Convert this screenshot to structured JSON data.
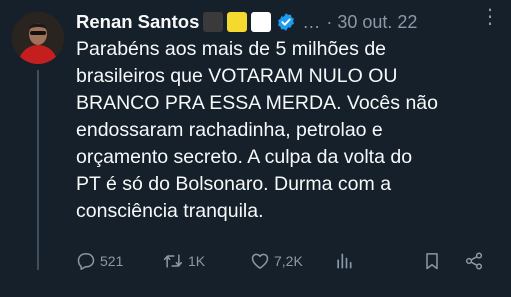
{
  "tweet": {
    "author": {
      "name": "Renan Santos",
      "badge_emojis": [
        "#3a3a3a",
        "#f5d92e",
        "#ffffff"
      ],
      "verified_color": "#1d9bf0"
    },
    "header_sep": "…",
    "date": "· 30 out. 22",
    "more_icon": "⋮",
    "text_lines": [
      "Parabéns aos mais de 5 milhões de",
      "brasileiros que VOTARAM NULO OU",
      "BRANCO PRA ESSA MERDA. Vocês não",
      "endossaram rachadinha, petrolao e",
      "orçamento secreto. A culpa da volta do",
      "PT é só do Bolsonaro. Durma com a",
      "consciência tranquila."
    ],
    "actions": {
      "replies": "521",
      "retweets": "1K",
      "likes": "7,2K"
    }
  },
  "colors": {
    "background": "#15202b",
    "text": "#f7f9f9",
    "muted": "#8b98a5",
    "accent": "#1d9bf0",
    "avatar_shirt": "#c41e1e"
  }
}
